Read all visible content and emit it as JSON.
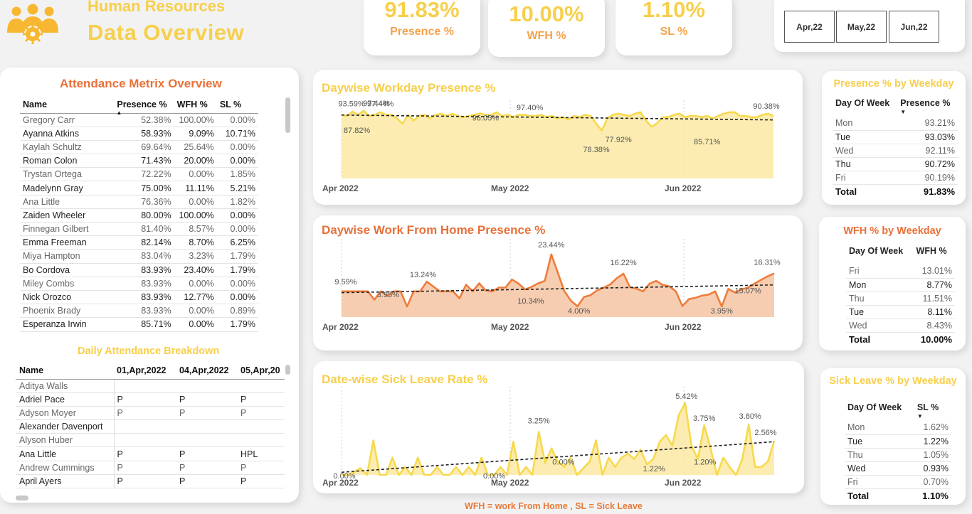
{
  "header": {
    "title": "Human Resources",
    "subtitle": "Data Overview"
  },
  "kpis": [
    {
      "value": "91.83%",
      "label": "Presence %"
    },
    {
      "value": "10.00%",
      "label": "WFH %"
    },
    {
      "value": "1.10%",
      "label": "SL %"
    }
  ],
  "months": [
    "Apr,22",
    "May,22",
    "Jun,22"
  ],
  "attendance": {
    "title": "Attendance Metrix Overview",
    "columns": [
      "Name",
      "Presence %",
      "WFH %",
      "SL %"
    ],
    "rows": [
      [
        "Gregory Carr",
        "52.38%",
        "100.00%",
        "0.00%"
      ],
      [
        "Ayanna Atkins",
        "58.93%",
        "9.09%",
        "10.71%"
      ],
      [
        "Kaylah Schultz",
        "69.64%",
        "25.64%",
        "0.00%"
      ],
      [
        "Roman Colon",
        "71.43%",
        "20.00%",
        "0.00%"
      ],
      [
        "Trystan Ortega",
        "72.22%",
        "0.00%",
        "1.85%"
      ],
      [
        "Madelynn Gray",
        "75.00%",
        "11.11%",
        "5.21%"
      ],
      [
        "Ana Little",
        "76.36%",
        "0.00%",
        "1.82%"
      ],
      [
        "Zaiden Wheeler",
        "80.00%",
        "100.00%",
        "0.00%"
      ],
      [
        "Finnegan Gilbert",
        "81.40%",
        "8.57%",
        "0.00%"
      ],
      [
        "Emma Freeman",
        "82.14%",
        "8.70%",
        "6.25%"
      ],
      [
        "Miya Hampton",
        "83.04%",
        "3.23%",
        "1.79%"
      ],
      [
        "Bo Cordova",
        "83.93%",
        "23.40%",
        "1.79%"
      ],
      [
        "Miley Combs",
        "83.93%",
        "0.00%",
        "0.00%"
      ],
      [
        "Nick Orozco",
        "83.93%",
        "12.77%",
        "0.00%"
      ],
      [
        "Phoenix Brady",
        "83.93%",
        "0.00%",
        "0.89%"
      ],
      [
        "Esperanza Irwin",
        "85.71%",
        "0.00%",
        "1.79%"
      ]
    ]
  },
  "daily": {
    "title": "Daily Attendance Breakdown",
    "columns": [
      "Name",
      "01,Apr,2022",
      "04,Apr,2022",
      "05,Apr,20"
    ],
    "rows": [
      [
        "Aditya Walls",
        "",
        "",
        ""
      ],
      [
        "Adriel Pace",
        "P",
        "P",
        "P"
      ],
      [
        "Adyson Moyer",
        "P",
        "P",
        "P"
      ],
      [
        "Alexander Davenport",
        "",
        "",
        ""
      ],
      [
        "Alyson Huber",
        "",
        "",
        ""
      ],
      [
        "Ana Little",
        "P",
        "P",
        "HPL"
      ],
      [
        "Andrew Cummings",
        "P",
        "P",
        "P"
      ],
      [
        "April Ayers",
        "P",
        "P",
        "P"
      ]
    ]
  },
  "chart_data": [
    {
      "type": "area",
      "title": "Daywise Workday Presence %",
      "x_ticks": [
        "Apr 2022",
        "May 2022",
        "Jun 2022"
      ],
      "ylim": [
        70,
        100
      ],
      "color": "#f7d94c",
      "fill": "#fbe9a3",
      "values": [
        97.4,
        96.9,
        98.8,
        97.4,
        99.1,
        96.9,
        97.4,
        98.5,
        97.4,
        97.4,
        95.9,
        93.6,
        97.4,
        94.9,
        96.9,
        97.4,
        95.9,
        97.4,
        97.9,
        96.9,
        97.9,
        96.9,
        96.4,
        96.9,
        97.4,
        98.0,
        97.4,
        97.4,
        98.5,
        96.9,
        97.4,
        96.4,
        97.4,
        97.4,
        96.9,
        96.9,
        97.4,
        96.4,
        96.9,
        95.9,
        96.4,
        95.4,
        96.9,
        96.4,
        97.4,
        96.9,
        93.6,
        90.7,
        95.9,
        97.4,
        97.9,
        97.4,
        96.9,
        97.9,
        98.5,
        94.9,
        92.3,
        93.8,
        96.4,
        96.4,
        97.4,
        97.9,
        96.4,
        96.9,
        96.9,
        96.4,
        96.9,
        95.9,
        96.9,
        97.9,
        98.5,
        98.5,
        96.9,
        96.9,
        96.4,
        96.4,
        97.4,
        97.9,
        96.9
      ],
      "trend": [
        97.3,
        95.2
      ],
      "labels": [
        "93.59%",
        "97.44%",
        "87.82%",
        "97.44%",
        "96.05%",
        "78.38%",
        "97.40%",
        "77.92%",
        "85.71%",
        "90.38%"
      ]
    },
    {
      "type": "area",
      "title": "Daywise Work From Home Presence %",
      "x_ticks": [
        "Apr 2022",
        "May 2022",
        "Jun 2022"
      ],
      "ylim": [
        0,
        26
      ],
      "color": "#ee7d3b",
      "fill": "#f6c4a3",
      "values": [
        9.6,
        9.6,
        9.6,
        9.6,
        9.6,
        6.5,
        9.6,
        7.9,
        9.6,
        9.6,
        3.95,
        9.6,
        9.6,
        13.2,
        11.4,
        9.6,
        9.6,
        9.6,
        7.0,
        12.1,
        9.6,
        12.6,
        9.9,
        9.6,
        11.0,
        11.0,
        14.0,
        12.5,
        10.3,
        11.3,
        12.6,
        13.5,
        23.4,
        16.5,
        9.6,
        6.1,
        4.0,
        7.5,
        8.2,
        10.0,
        11.0,
        12.2,
        14.5,
        16.2,
        11.2,
        10.6,
        9.6,
        12.5,
        13.5,
        12.0,
        11.5,
        9.6,
        4.1,
        6.7,
        7.2,
        8.0,
        8.4,
        9.6,
        3.95,
        10.5,
        9.2,
        10.3,
        11.0,
        12.5,
        13.9,
        15.2,
        16.3
      ],
      "trend": [
        9.1,
        12.0
      ],
      "labels": [
        "9.59%",
        "13.24%",
        "3.95%",
        "10.34%",
        "23.44%",
        "4.00%",
        "16.22%",
        "3.95%",
        "15.07%",
        "16.31%"
      ]
    },
    {
      "type": "area",
      "title": "Date-wise Sick Leave Rate %",
      "x_ticks": [
        "Apr 2022",
        "May 2022",
        "Jun 2022"
      ],
      "ylim": [
        0,
        6
      ],
      "color": "#f7d94c",
      "fill": "#fbe9a3",
      "values": [
        0.0,
        0.0,
        0.25,
        0.5,
        0.0,
        2.6,
        0.0,
        0.0,
        1.3,
        0.0,
        0.6,
        0.0,
        1.3,
        0.0,
        0.0,
        0.6,
        0.0,
        0.0,
        0.6,
        0.0,
        0.6,
        0.0,
        1.3,
        0.0,
        0.0,
        0.6,
        0.0,
        2.5,
        0.0,
        0.6,
        0.0,
        3.25,
        0.9,
        2.0,
        1.0,
        0.6,
        1.3,
        0.0,
        0.5,
        1.0,
        2.6,
        0.0,
        1.3,
        0.6,
        1.3,
        1.6,
        1.2,
        1.9,
        0.8,
        1.2,
        2.5,
        3.0,
        2.2,
        4.5,
        5.42,
        2.2,
        1.2,
        3.75,
        2.0,
        0.0,
        1.3,
        0.6,
        0.0,
        1.2,
        3.8,
        0.6,
        0.6,
        1.0,
        2.56
      ],
      "trend": [
        0.2,
        2.5
      ],
      "labels": [
        "0.00%",
        "0.00%",
        "3.25%",
        "0.00%",
        "1.22%",
        "1.20%",
        "5.42%",
        "3.75%",
        "3.80%",
        "2.56%"
      ]
    }
  ],
  "presence_weekday": {
    "title": "Presence % by Weekday",
    "columns": [
      "Day Of Week",
      "Presence %"
    ],
    "rows": [
      [
        "Mon",
        "93.21%"
      ],
      [
        "Tue",
        "93.03%"
      ],
      [
        "Wed",
        "92.11%"
      ],
      [
        "Thu",
        "90.72%"
      ],
      [
        "Fri",
        "90.19%"
      ]
    ],
    "total": [
      "Total",
      "91.83%"
    ]
  },
  "wfh_weekday": {
    "title": "WFH % by Weekday",
    "columns": [
      "Day Of Week",
      "WFH %"
    ],
    "rows": [
      [
        "Fri",
        "13.01%"
      ],
      [
        "Mon",
        "8.77%"
      ],
      [
        "Thu",
        "11.51%"
      ],
      [
        "Tue",
        "8.11%"
      ],
      [
        "Wed",
        "8.43%"
      ]
    ],
    "total": [
      "Total",
      "10.00%"
    ]
  },
  "sl_weekday": {
    "title": "Sick Leave % by Weekday",
    "columns": [
      "Day Of Week",
      "SL %"
    ],
    "rows": [
      [
        "Mon",
        "1.62%"
      ],
      [
        "Tue",
        "1.22%"
      ],
      [
        "Thu",
        "1.05%"
      ],
      [
        "Wed",
        "0.93%"
      ],
      [
        "Fri",
        "0.70%"
      ]
    ],
    "total": [
      "Total",
      "1.10%"
    ]
  },
  "footnote": "WFH = work From Home , SL = Sick Leave",
  "colors": {
    "yellow": "#f7cf4b",
    "orange": "#ee7d3b",
    "title_orange": "#e8703a"
  }
}
